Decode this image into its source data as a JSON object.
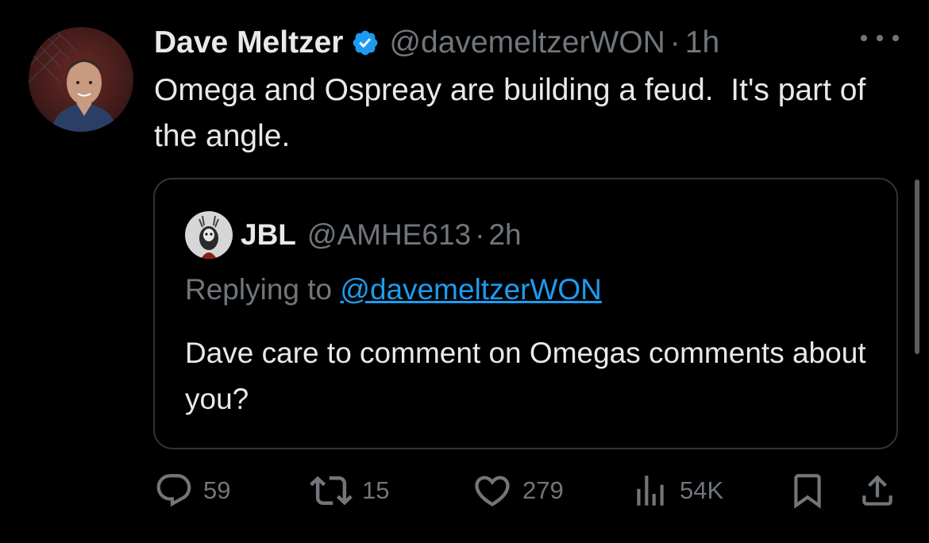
{
  "tweet": {
    "display_name": "Dave Meltzer",
    "handle": "@davemeltzerWON",
    "separator": "·",
    "time": "1h",
    "text": "Omega and Ospreay are building a feud.  It's part of the angle.",
    "verified": true
  },
  "quote": {
    "display_name": "JBL",
    "handle": "@AMHE613",
    "separator": "·",
    "time": "2h",
    "replying_prefix": "Replying to ",
    "replying_to": "@davemeltzerWON",
    "text": "Dave care to comment on Omegas comments about you?"
  },
  "actions": {
    "replies": "59",
    "reposts": "15",
    "likes": "279",
    "views": "54K"
  },
  "colors": {
    "background": "#000000",
    "text": "#e7e9ea",
    "muted": "#71767b",
    "accent": "#1d9bf0",
    "border": "#2f3336"
  },
  "icons": {
    "more": "more-icon",
    "verified": "verified-badge-icon",
    "reply": "reply-icon",
    "repost": "repost-icon",
    "like": "like-icon",
    "views": "views-icon",
    "bookmark": "bookmark-icon",
    "share": "share-icon"
  }
}
